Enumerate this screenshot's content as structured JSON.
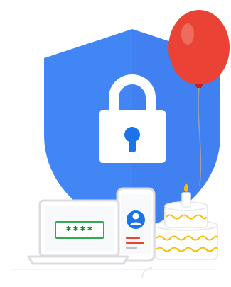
{
  "password_mask": "****",
  "colors": {
    "shield": "#4285F4",
    "shield_shade": "#3b78e7",
    "lock": "#ffffff",
    "keyhole": "#1a73e8",
    "balloon": "#ea4335",
    "balloon_highlight": "#f28b82",
    "balloon_string": "#9aa0a6",
    "laptop_frame": "#dadce0",
    "laptop_screen": "#f8f9fa",
    "password_field_border": "#34a853",
    "password_text": "#188038",
    "phone_frame": "#dadce0",
    "phone_avatar": "#1a73e8",
    "phone_text_red": "#ea4335",
    "phone_text_gray": "#bdc1c6",
    "cake_body": "#ffffff",
    "cake_frosting": "#fbbc04",
    "candle": "#ffffff",
    "flame": "#fbbc04",
    "outline": "#e8eaed"
  },
  "icons": {
    "shield": "shield-icon",
    "lock": "lock-icon",
    "balloon": "balloon-icon",
    "laptop": "laptop-icon",
    "phone": "phone-icon",
    "cake": "birthday-cake-icon"
  }
}
